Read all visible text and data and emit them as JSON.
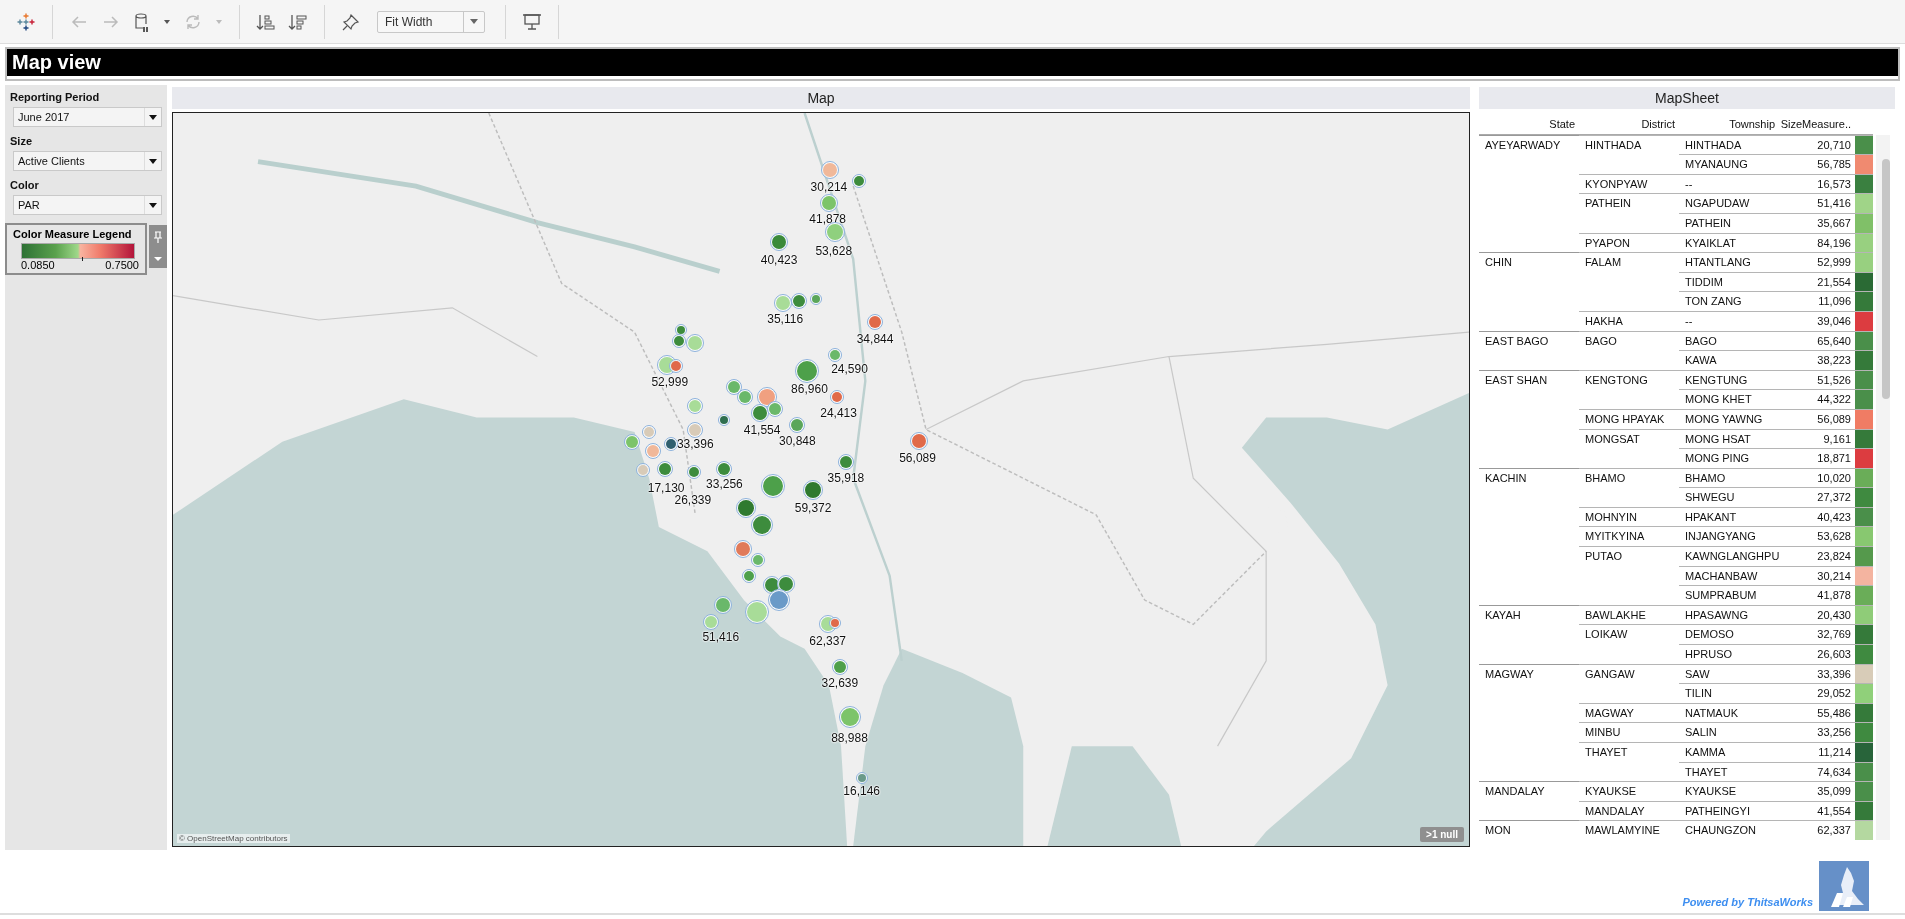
{
  "toolbar": {
    "zoom_mode": "Fit Width"
  },
  "dashboard": {
    "title": "Map view"
  },
  "filters": [
    {
      "label": "Reporting Period",
      "value": "June 2017"
    },
    {
      "label": "Size",
      "value": "Active Clients"
    },
    {
      "label": "Color",
      "value": "PAR"
    }
  ],
  "legend": {
    "title": "Color Measure Legend",
    "min": "0.0850",
    "max": "0.7500"
  },
  "map": {
    "title": "Map",
    "attribution": "© OpenStreetMap contributors",
    "null_badge": ">1 null",
    "marks": [
      {
        "color": "#f0b89a",
        "label": "30,214"
      },
      {
        "color": "#3d8c3d"
      },
      {
        "color": "#7cc46a",
        "label": "41,878"
      },
      {
        "color": "#8fd07e",
        "label": "53,628"
      },
      {
        "color": "#3a8a3a",
        "label": "40,423"
      },
      {
        "color": "#a8dc98",
        "label": "35,116"
      },
      {
        "color": "#3d8c3d"
      },
      {
        "color": "#5aa65a"
      },
      {
        "color": "#e06a4a",
        "label": "34,844"
      },
      {
        "color": "#6ab86a",
        "label": "24,590"
      },
      {
        "color": "#4da04a",
        "label": "86,960"
      },
      {
        "color": "#e06a4a",
        "label": "24,413"
      },
      {
        "color": "#f0a080"
      },
      {
        "color": "#6ab86a"
      },
      {
        "color": "#6ab86a"
      },
      {
        "color": "#3d8c3d",
        "label": "41,554"
      },
      {
        "color": "#6ab86a"
      },
      {
        "color": "#5aa65a",
        "label": "30,848"
      },
      {
        "color": "#a8dc98",
        "label": "52,999"
      },
      {
        "color": "#e06a4a"
      },
      {
        "color": "#3d8c3d"
      },
      {
        "color": "#3d8c3d"
      },
      {
        "color": "#a8dc98"
      },
      {
        "color": "#a8dc98"
      },
      {
        "color": "#2f6f4f"
      },
      {
        "color": "#d8cbb8",
        "label": "33,396"
      },
      {
        "color": "#e06a4a",
        "label": "56,089"
      },
      {
        "color": "#7cc46a"
      },
      {
        "color": "#d8cbb8"
      },
      {
        "color": "#f0b89a"
      },
      {
        "color": "#2f5f6f"
      },
      {
        "color": "#d8cbb8"
      },
      {
        "color": "#3d8c3d",
        "label": "17,130"
      },
      {
        "color": "#3d8c3d",
        "label": "26,339"
      },
      {
        "color": "#3d8c3d",
        "label": "33,256"
      },
      {
        "color": "#3d8c3d",
        "label": "35,918"
      },
      {
        "color": "#4da04a"
      },
      {
        "color": "#2f7a2f",
        "label": "59,372"
      },
      {
        "color": "#2f7a2f"
      },
      {
        "color": "#3d8c3d"
      },
      {
        "color": "#e07a5a"
      },
      {
        "color": "#6ab86a"
      },
      {
        "color": "#4da04a"
      },
      {
        "color": "#3d8c3d"
      },
      {
        "color": "#3d8c3d"
      },
      {
        "color": "#6ab86a",
        "label": "51,416"
      },
      {
        "color": "#a8dc98"
      },
      {
        "color": "#a8dc98"
      },
      {
        "color": "#6a9ac8"
      },
      {
        "color": "#a8dc98",
        "label": "62,337"
      },
      {
        "color": "#e06a4a"
      },
      {
        "color": "#4da04a",
        "label": "32,639"
      },
      {
        "color": "#7cc46a",
        "label": "88,988"
      },
      {
        "color": "#6a9a8a",
        "label": "16,146"
      }
    ]
  },
  "table": {
    "title": "MapSheet",
    "columns": [
      "State",
      "District",
      "Township",
      "SizeMeasure.."
    ],
    "states": [
      {
        "name": "AYEYARWADY",
        "districts": [
          {
            "name": "HINTHADA",
            "townships": [
              {
                "name": "HINTHADA",
                "value": "20,710",
                "color": "#4a8f4a"
              },
              {
                "name": "MYANAUNG",
                "value": "56,785",
                "color": "#f08a70"
              }
            ]
          },
          {
            "name": "KYONPYAW",
            "townships": [
              {
                "name": "--",
                "value": "16,573",
                "color": "#3a8040"
              }
            ]
          },
          {
            "name": "PATHEIN",
            "townships": [
              {
                "name": "NGAPUDAW",
                "value": "51,416",
                "color": "#a0d488"
              },
              {
                "name": "PATHEIN",
                "value": "35,667",
                "color": "#80c068"
              }
            ]
          },
          {
            "name": "PYAPON",
            "townships": [
              {
                "name": "KYAIKLAT",
                "value": "84,196",
                "color": "#98d080"
              }
            ]
          }
        ]
      },
      {
        "name": "CHIN",
        "districts": [
          {
            "name": "FALAM",
            "townships": [
              {
                "name": "HTANTLANG",
                "value": "52,999",
                "color": "#98d080"
              },
              {
                "name": "TIDDIM",
                "value": "21,554",
                "color": "#2a6a34"
              },
              {
                "name": "TON ZANG",
                "value": "11,096",
                "color": "#357a3a"
              }
            ]
          },
          {
            "name": "HAKHA",
            "townships": [
              {
                "name": "--",
                "value": "39,046",
                "color": "#dc3c40"
              }
            ]
          }
        ]
      },
      {
        "name": "EAST BAGO",
        "districts": [
          {
            "name": "BAGO",
            "townships": [
              {
                "name": "BAGO",
                "value": "65,640",
                "color": "#4a8f4a"
              },
              {
                "name": "KAWA",
                "value": "38,223",
                "color": "#357a3a"
              }
            ]
          }
        ]
      },
      {
        "name": "EAST SHAN",
        "districts": [
          {
            "name": "KENGTONG",
            "townships": [
              {
                "name": "KENGTUNG",
                "value": "51,526",
                "color": "#4a8f4a"
              },
              {
                "name": "MONG KHET",
                "value": "44,322",
                "color": "#4a8f4a"
              }
            ]
          },
          {
            "name": "MONG HPAYAK",
            "townships": [
              {
                "name": "MONG YAWNG",
                "value": "56,089",
                "color": "#f07c64"
              }
            ]
          },
          {
            "name": "MONGSAT",
            "townships": [
              {
                "name": "MONG HSAT",
                "value": "9,161",
                "color": "#357a3a"
              },
              {
                "name": "MONG PING",
                "value": "18,871",
                "color": "#dc3c40"
              }
            ]
          }
        ]
      },
      {
        "name": "KACHIN",
        "districts": [
          {
            "name": "BHAMO",
            "townships": [
              {
                "name": "BHAMO",
                "value": "10,020",
                "color": "#6aad58"
              },
              {
                "name": "SHWEGU",
                "value": "27,372",
                "color": "#3f8a40"
              }
            ]
          },
          {
            "name": "MOHNYIN",
            "townships": [
              {
                "name": "HPAKANT",
                "value": "40,423",
                "color": "#4a8f4a"
              }
            ]
          },
          {
            "name": "MYITKYINA",
            "townships": [
              {
                "name": "INJANGYANG",
                "value": "53,628",
                "color": "#88c870"
              }
            ]
          },
          {
            "name": "PUTAO",
            "townships": [
              {
                "name": "KAWNGLANGHPU",
                "value": "23,824",
                "color": "#55994c"
              },
              {
                "name": "MACHANBAW",
                "value": "30,214",
                "color": "#f4b4a0"
              },
              {
                "name": "SUMPRABUM",
                "value": "41,878",
                "color": "#6aad58"
              }
            ]
          }
        ]
      },
      {
        "name": "KAYAH",
        "districts": [
          {
            "name": "BAWLAKHE",
            "townships": [
              {
                "name": "HPASAWNG",
                "value": "20,430",
                "color": "#8fcc78"
              }
            ]
          },
          {
            "name": "LOIKAW",
            "townships": [
              {
                "name": "DEMOSO",
                "value": "32,769",
                "color": "#357a3a"
              },
              {
                "name": "HPRUSO",
                "value": "26,603",
                "color": "#3f8a40"
              }
            ]
          }
        ]
      },
      {
        "name": "MAGWAY",
        "districts": [
          {
            "name": "GANGAW",
            "townships": [
              {
                "name": "SAW",
                "value": "33,396",
                "color": "#d8ccb8"
              },
              {
                "name": "TILIN",
                "value": "29,052",
                "color": "#90d07a"
              }
            ]
          },
          {
            "name": "MAGWAY",
            "townships": [
              {
                "name": "NATMAUK",
                "value": "55,486",
                "color": "#357a3a"
              }
            ]
          },
          {
            "name": "MINBU",
            "townships": [
              {
                "name": "SALIN",
                "value": "33,256",
                "color": "#3f8a40"
              }
            ]
          },
          {
            "name": "THAYET",
            "townships": [
              {
                "name": "KAMMA",
                "value": "11,214",
                "color": "#28643a"
              },
              {
                "name": "THAYET",
                "value": "74,634",
                "color": "#4a8f4a"
              }
            ]
          }
        ]
      },
      {
        "name": "MANDALAY",
        "districts": [
          {
            "name": "KYAUKSE",
            "townships": [
              {
                "name": "KYAUKSE",
                "value": "35,099",
                "color": "#4a8f4a"
              }
            ]
          },
          {
            "name": "MANDALAY",
            "townships": [
              {
                "name": "PATHEINGYI",
                "value": "41,554",
                "color": "#357a3a"
              }
            ]
          }
        ]
      },
      {
        "name": "MON",
        "districts": [
          {
            "name": "MAWLAMYINE",
            "townships": [
              {
                "name": "CHAUNGZON",
                "value": "62,337",
                "color": "#b4d8a0"
              }
            ]
          }
        ]
      }
    ]
  },
  "footer": {
    "credit": "Powered by ThitsaWorks"
  }
}
